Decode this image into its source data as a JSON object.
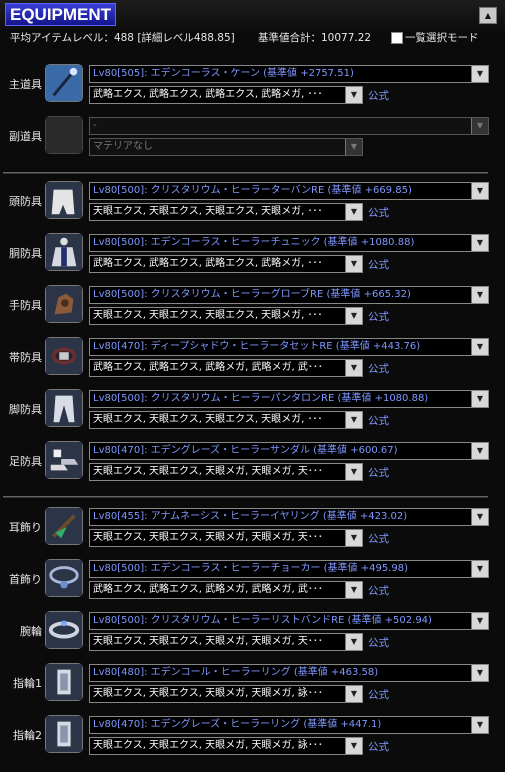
{
  "header": {
    "title": "EQUIPMENT",
    "collapse_icon": "triangle-up-icon"
  },
  "summary": {
    "avg_level": "平均アイテムレベル：488 [詳細レベル488.85]",
    "total": "基準値合計：10077.22",
    "list_mode_label": "一覧選択モード",
    "list_mode_checked": false
  },
  "slots": [
    {
      "label": "主道具",
      "item": "Lv80[505]: エデンコーラス・ケーン (基準値 +2757.51)",
      "materia": "武略エクス, 武略エクス, 武略エクス, 武略メガ, ･･･",
      "official": "公式",
      "icon": "cane-icon",
      "disabled": false
    },
    {
      "label": "副道具",
      "item": "-",
      "materia": "マテリアなし",
      "official": "",
      "icon": "empty-slot-icon",
      "disabled": true
    },
    {
      "label": "頭防具",
      "item": "Lv80[500]: クリスタリウム・ヒーラーターバンRE (基準値 +669.85)",
      "materia": "天眼エクス, 天眼エクス, 天眼エクス, 天眼メガ, ･･･",
      "official": "公式",
      "icon": "turban-icon",
      "disabled": false
    },
    {
      "label": "胴防具",
      "item": "Lv80[500]: エデンコーラス・ヒーラーチュニック (基準値 +1080.88)",
      "materia": "武略エクス, 武略エクス, 武略エクス, 武略メガ, ･･･",
      "official": "公式",
      "icon": "tunic-icon",
      "disabled": false
    },
    {
      "label": "手防具",
      "item": "Lv80[500]: クリスタリウム・ヒーラーグローブRE (基準値 +665.32)",
      "materia": "天眼エクス, 天眼エクス, 天眼エクス, 天眼メガ, ･･･",
      "official": "公式",
      "icon": "glove-icon",
      "disabled": false
    },
    {
      "label": "帯防具",
      "item": "Lv80[470]: ディープシャドウ・ヒーラータセットRE (基準値 +443.76)",
      "materia": "武略エクス, 武略エクス, 武略メガ, 武略メガ, 武･･･",
      "official": "公式",
      "icon": "tasset-icon",
      "disabled": false
    },
    {
      "label": "脚防具",
      "item": "Lv80[500]: クリスタリウム・ヒーラーパンタロンRE (基準値 +1080.88)",
      "materia": "天眼エクス, 天眼エクス, 天眼エクス, 天眼メガ, ･･･",
      "official": "公式",
      "icon": "pantaloon-icon",
      "disabled": false
    },
    {
      "label": "足防具",
      "item": "Lv80[470]: エデングレーズ・ヒーラーサンダル (基準値 +600.67)",
      "materia": "天眼エクス, 天眼エクス, 天眼メガ, 天眼メガ, 天･･･",
      "official": "公式",
      "icon": "sandal-icon",
      "disabled": false
    },
    {
      "label": "耳飾り",
      "item": "Lv80[455]: アナムネーシス・ヒーラーイヤリング (基準値 +423.02)",
      "materia": "天眼エクス, 天眼エクス, 天眼メガ, 天眼メガ, 天･･･",
      "official": "公式",
      "icon": "earring-icon",
      "disabled": false
    },
    {
      "label": "首飾り",
      "item": "Lv80[500]: エデンコーラス・ヒーラーチョーカー (基準値 +495.98)",
      "materia": "武略エクス, 武略エクス, 武略メガ, 武略メガ, 武･･･",
      "official": "公式",
      "icon": "choker-icon",
      "disabled": false
    },
    {
      "label": "腕輪",
      "item": "Lv80[500]: クリスタリウム・ヒーラーリストバンドRE (基準値 +502.94)",
      "materia": "天眼エクス, 天眼エクス, 天眼メガ, 天眼メガ, 天･･･",
      "official": "公式",
      "icon": "wristband-icon",
      "disabled": false
    },
    {
      "label": "指輪1",
      "item": "Lv80[480]: エデンコール・ヒーラーリング (基準値 +463.58)",
      "materia": "天眼エクス, 天眼エクス, 天眼メガ, 天眼メガ, 詠･･･",
      "official": "公式",
      "icon": "ring-icon",
      "disabled": false
    },
    {
      "label": "指輪2",
      "item": "Lv80[470]: エデングレーズ・ヒーラーリング (基準値 +447.1)",
      "materia": "天眼エクス, 天眼エクス, 天眼メガ, 天眼メガ, 詠･･･",
      "official": "公式",
      "icon": "ring-icon",
      "disabled": false
    }
  ]
}
